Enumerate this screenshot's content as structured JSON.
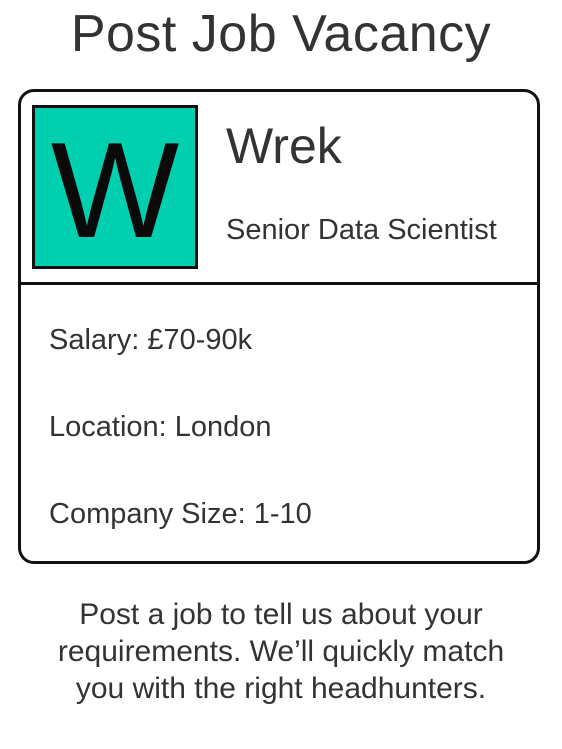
{
  "page": {
    "title": "Post Job Vacancy"
  },
  "job_card": {
    "logo": {
      "letter": "W",
      "background_color": "#00CFB0"
    },
    "company_name": "Wrek",
    "job_title": "Senior Data Scientist",
    "details": {
      "salary": "Salary: £70-90k",
      "location": "Location: London",
      "company_size": "Company Size: 1-10"
    }
  },
  "description": {
    "line1": "Post a job to tell us about your",
    "line2": "requirements. We’ll quickly match",
    "line3": "you with the right headhunters."
  }
}
